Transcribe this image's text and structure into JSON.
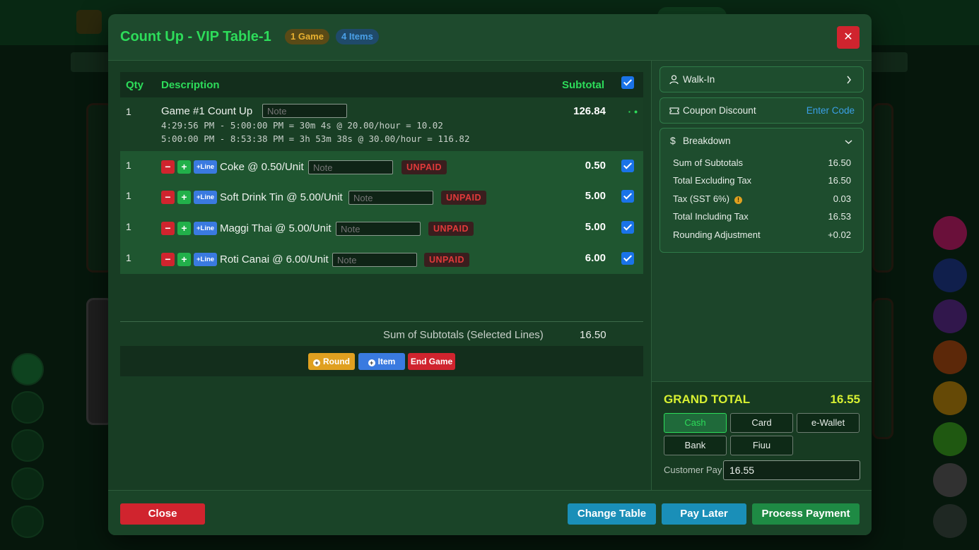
{
  "modal": {
    "title": "Count Up - VIP Table-1",
    "badge_games": "1 Game",
    "badge_items": "4 Items",
    "close_symbol": "✕"
  },
  "table": {
    "headers": {
      "qty": "Qty",
      "description": "Description",
      "subtotal": "Subtotal"
    },
    "game": {
      "qty": "1",
      "title": "Game #1  Count Up",
      "note_placeholder": "Note",
      "line1": "4:29:56 PM - 5:00:00 PM = 30m 4s @ 20.00/hour = 10.02",
      "line2": "5:00:00 PM - 8:53:38 PM = 3h 53m 38s @ 30.00/hour = 116.82",
      "subtotal": "126.84",
      "more": "· •"
    },
    "items": [
      {
        "qty": "1",
        "name": "Coke @ 0.50/Unit",
        "note_placeholder": "Note",
        "status": "UNPAID",
        "subtotal": "0.50",
        "checked": true
      },
      {
        "qty": "1",
        "name": "Soft Drink Tin @ 5.00/Unit",
        "note_placeholder": "Note",
        "status": "UNPAID",
        "subtotal": "5.00",
        "checked": true
      },
      {
        "qty": "1",
        "name": "Maggi Thai @ 5.00/Unit",
        "note_placeholder": "Note",
        "status": "UNPAID",
        "subtotal": "5.00",
        "checked": true
      },
      {
        "qty": "1",
        "name": "Roti Canai @ 6.00/Unit",
        "note_placeholder": "Note",
        "status": "UNPAID",
        "subtotal": "6.00",
        "checked": true
      }
    ],
    "line_controls": {
      "minus": "−",
      "plus": "+",
      "add_line": "+Line"
    },
    "sum_label": "Sum of Subtotals (Selected Lines)",
    "sum_value": "16.50"
  },
  "actions": {
    "round": "Round",
    "item": "Item",
    "end_game": "End Game",
    "add_symbol": "+"
  },
  "sidebar": {
    "customer": "Walk-In",
    "coupon_label": "Coupon Discount",
    "coupon_action": "Enter Code",
    "breakdown_title": "Breakdown",
    "breakdown": [
      {
        "label": "Sum of Subtotals",
        "value": "16.50"
      },
      {
        "label": "Total Excluding Tax",
        "value": "16.50"
      },
      {
        "label": "Tax (SST 6%)",
        "value": "0.03",
        "info": true
      },
      {
        "label": "Total Including Tax",
        "value": "16.53"
      },
      {
        "label": "Rounding Adjustment",
        "value": "+0.02"
      }
    ],
    "grand_total_label": "GRAND TOTAL",
    "grand_total_value": "16.55",
    "payment_methods": [
      "Cash",
      "Card",
      "e-Wallet",
      "Bank",
      "Fiuu"
    ],
    "selected_method": "Cash",
    "customer_pay_label": "Customer Pay",
    "customer_pay_value": "16.55"
  },
  "footer": {
    "close": "Close",
    "change_table": "Change Table",
    "pay_later": "Pay Later",
    "process_payment": "Process Payment"
  },
  "colors": {
    "accent_green": "#2ddc5a",
    "danger": "#d0242e",
    "grand_total": "#d8f032",
    "info_blue": "#1a8fb8",
    "process_green": "#1e8a44"
  },
  "icons": {
    "user": "user-icon",
    "chevron_right": "chevron-right-icon",
    "coupon": "ticket-icon",
    "dollar": "dollar-icon",
    "chevron_down": "chevron-down-icon",
    "info": "info-icon",
    "close": "close-icon"
  }
}
